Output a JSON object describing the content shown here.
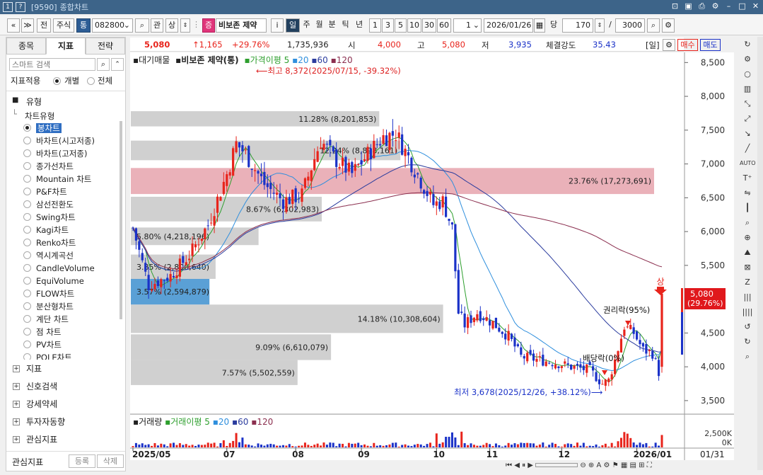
{
  "window": {
    "code": "[9590]",
    "title": "종합차트",
    "left_icons": [
      "1",
      "?"
    ]
  },
  "toolbar": {
    "nav_prev": "«",
    "nav_menu": "≫",
    "btn_jeon": "전",
    "btn_stock": "주식",
    "btn_tong": "통",
    "code_value": "082800",
    "btn_gwan": "관",
    "btn_sang": "상",
    "badge_jeung": "증",
    "stock_name": "비보존 제약",
    "btn_info": "i",
    "periods": [
      "일",
      "주",
      "월",
      "분",
      "틱",
      "년"
    ],
    "active_period": "일",
    "minute_options": [
      "1",
      "3",
      "5",
      "10",
      "30",
      "60"
    ],
    "select_value": "1",
    "date_value": "2026/01/26",
    "dang_label": "당",
    "count_value": "170",
    "slash": "/",
    "max_value": "3000"
  },
  "left_panel": {
    "tabs": [
      "종목",
      "지표",
      "전략"
    ],
    "active_tab": "지표",
    "search_placeholder": "스마트 검색",
    "apply_label": "지표적용",
    "apply_options": [
      "개별",
      "전체"
    ],
    "apply_selected": "개별",
    "folder_label": "유형",
    "subtree_label": "차트유형",
    "chart_types": [
      "봉차트",
      "바차트(시고저종)",
      "바차트(고저종)",
      "종가선차트",
      "Mountain 차트",
      "P&F차트",
      "삼선전환도",
      "Swing차트",
      "Kagi차트",
      "Renko차트",
      "역시계곡선",
      "CandleVolume",
      "EquiVolume",
      "FLOW차트",
      "분산형차트",
      "계단 차트",
      "점 차트",
      "PV차트",
      "POLE차트"
    ],
    "selected_type": "봉차트",
    "tree_items": [
      "지표",
      "신호검색",
      "강세약세",
      "투자자동향",
      "관심지표"
    ],
    "bottom_label": "관심지표",
    "btn_register": "등록",
    "btn_delete": "삭제"
  },
  "info_bar": {
    "price": "5,080",
    "change": "↑1,165",
    "change_pct": "+29.76%",
    "volume": "1,735,936",
    "open_label": "시",
    "open": "4,000",
    "high_label": "고",
    "high": "5,080",
    "low_label": "저",
    "low": "3,935",
    "strength_label": "체결강도",
    "strength": "35.43",
    "period_tag": "[일]",
    "buy": "매수",
    "sell": "매도"
  },
  "chart_data": {
    "type": "candlestick",
    "legend": {
      "series_label": "대기매물",
      "name": "비보존 제약(통)",
      "ma_label": "가격이평",
      "ma_periods": [
        "5",
        "20",
        "60",
        "120"
      ],
      "ma_colors": [
        "#2e9f2e",
        "#2f8fdd",
        "#2b3c9e",
        "#8b2f4f"
      ]
    },
    "y_ticks": [
      "8,500",
      "8,000",
      "7,500",
      "7,000",
      "6,500",
      "6,000",
      "5,500",
      "5,000",
      "4,500",
      "4,000",
      "3,500"
    ],
    "ylim": [
      3300,
      8650
    ],
    "x_labels": [
      "2025/05",
      "07",
      "08",
      "09",
      "10",
      "11",
      "12",
      "2026/01"
    ],
    "x_label_index": [
      0,
      30,
      52,
      73,
      97,
      114,
      137,
      161
    ],
    "n_candles": 170,
    "annotations": {
      "high_note": "최고 8,372(2025/07/15, -39.32%)",
      "low_note": "최저 3,678(2025/12/26, +38.12%)",
      "event_rights": "권리락(95%)",
      "event_dividend": "배당락(0%)",
      "upper_limit": "상",
      "last_price_tag": "5,080",
      "last_pct_tag": "(29.76%)"
    },
    "volume_profile": [
      {
        "label": "11.28% (8,201,853)",
        "price_low": 7555,
        "price_high": 7780,
        "pct": 11.28
      },
      {
        "label": "12.24% (8,898,161)",
        "price_low": 7055,
        "price_high": 7345,
        "pct": 12.24
      },
      {
        "label": "23.76% (17,273,691)",
        "price_low": 6555,
        "price_high": 6940,
        "pct": 23.76
      },
      {
        "label": "8.67% (6,302,983)",
        "price_low": 6150,
        "price_high": 6515,
        "pct": 8.67
      },
      {
        "label": "5.80% (4,218,196)",
        "price_low": 5800,
        "price_high": 6060,
        "pct": 5.8
      },
      {
        "label": "3.85% (2,800,640)",
        "price_low": 5300,
        "price_high": 5660,
        "pct": 3.85
      },
      {
        "label": "3.57% (2,594,879)",
        "price_low": 4920,
        "price_high": 5300,
        "pct": 3.57
      },
      {
        "label": "14.18% (10,308,604)",
        "price_low": 4500,
        "price_high": 4920,
        "pct": 14.18
      },
      {
        "label": "9.09% (6,610,079)",
        "price_low": 4100,
        "price_high": 4480,
        "pct": 9.09
      },
      {
        "label": "7.57% (5,502,559)",
        "price_low": 3730,
        "price_high": 4100,
        "pct": 7.57
      }
    ],
    "volume_panel": {
      "label": "거래량",
      "ma_label": "거래이평",
      "ma_periods": [
        "5",
        "20",
        "60",
        "120"
      ],
      "y_ticks": [
        "2,500K",
        "0K"
      ],
      "last_label": "01/31"
    }
  },
  "colors": {
    "up": "#e8241c",
    "down": "#1b32c8",
    "profile_gray": "#c8c8c8",
    "profile_red": "#e6a3ad",
    "profile_blue": "#3d8fcf",
    "price_tag": "#e0181c"
  }
}
